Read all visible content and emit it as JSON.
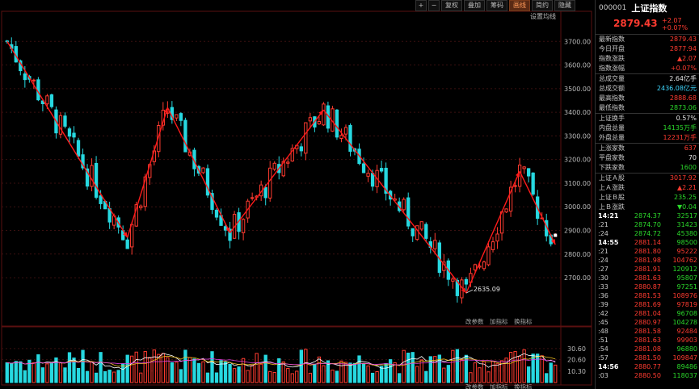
{
  "toolbar": {
    "items": [
      "+",
      "−",
      "复权",
      "叠加",
      "筹码",
      "画线",
      "简约",
      "隐藏"
    ],
    "active": "画线",
    "ma_setting": "设置均线"
  },
  "sub_labels": {
    "main_right": [
      "改参数",
      "加指标",
      "换指标"
    ],
    "vol_right": [
      "改参数",
      "加指标",
      "换指标"
    ]
  },
  "colors": {
    "up": "#ff3b30",
    "down": "#27d8e0",
    "zigzag": "#ff1a1a",
    "grid": "#3a1010"
  },
  "header": {
    "code": "000001",
    "name": "上证指数",
    "price": "2879.43",
    "change": "+2.07",
    "change_pct": "+0.07%"
  },
  "stats": [
    {
      "label": "最新指数",
      "value": "2879.43",
      "color": "red"
    },
    {
      "label": "今日开盘",
      "value": "2877.94",
      "color": "red"
    },
    {
      "label": "指数涨跌",
      "value": "▲2.07",
      "color": "red"
    },
    {
      "label": "指数涨幅",
      "value": "+0.07%",
      "color": "red"
    },
    {
      "label": "总成交量",
      "value": "2.64亿手",
      "color": "white"
    },
    {
      "label": "总成交额",
      "value": "2436.08亿元",
      "color": "cyan"
    },
    {
      "label": "最高指数",
      "value": "2888.68",
      "color": "red"
    },
    {
      "label": "最低指数",
      "value": "2873.06",
      "color": "green"
    },
    {
      "label": "上证换手",
      "value": "0.57%",
      "color": "white"
    },
    {
      "label": "内盘总量",
      "value": "14135万手",
      "color": "green"
    },
    {
      "label": "外盘总量",
      "value": "12231万手",
      "color": "red"
    },
    {
      "label": "上涨家数",
      "value": "637",
      "color": "red"
    },
    {
      "label": "平盘家数",
      "value": "70",
      "color": "white"
    },
    {
      "label": "下跌家数",
      "value": "1600",
      "color": "green"
    },
    {
      "label": "上证Ａ股",
      "value": "3017.92",
      "color": "red"
    },
    {
      "label": "上Ａ涨跌",
      "value": "▲2.21",
      "color": "red"
    },
    {
      "label": "上证Ｂ股",
      "value": "235.25",
      "color": "green"
    },
    {
      "label": "上Ｂ涨跌",
      "value": "▼0.04",
      "color": "green"
    }
  ],
  "ticks": [
    {
      "time": "14:21",
      "price": "2874.37",
      "vol": "32517",
      "pc": "green",
      "vc": "green"
    },
    {
      "time": ":21",
      "price": "2874.70",
      "vol": "31423",
      "pc": "green",
      "vc": "green"
    },
    {
      "time": ":24",
      "price": "2874.72",
      "vol": "45380",
      "pc": "green",
      "vc": "green"
    },
    {
      "time": "14:55",
      "price": "2881.14",
      "vol": "98500",
      "pc": "red",
      "vc": "green"
    },
    {
      "time": ":21",
      "price": "2881.80",
      "vol": "95222",
      "pc": "red",
      "vc": "red"
    },
    {
      "time": ":24",
      "price": "2881.98",
      "vol": "104762",
      "pc": "red",
      "vc": "red"
    },
    {
      "time": ":27",
      "price": "2881.91",
      "vol": "120912",
      "pc": "red",
      "vc": "green"
    },
    {
      "time": ":30",
      "price": "2881.63",
      "vol": "95807",
      "pc": "red",
      "vc": "green"
    },
    {
      "time": ":33",
      "price": "2880.87",
      "vol": "97251",
      "pc": "red",
      "vc": "green"
    },
    {
      "time": ":36",
      "price": "2881.53",
      "vol": "108976",
      "pc": "red",
      "vc": "red"
    },
    {
      "time": ":39",
      "price": "2881.69",
      "vol": "97819",
      "pc": "red",
      "vc": "red"
    },
    {
      "time": ":42",
      "price": "2881.04",
      "vol": "96708",
      "pc": "red",
      "vc": "green"
    },
    {
      "time": ":45",
      "price": "2880.97",
      "vol": "104278",
      "pc": "red",
      "vc": "green"
    },
    {
      "time": ":48",
      "price": "2881.58",
      "vol": "92484",
      "pc": "red",
      "vc": "red"
    },
    {
      "time": ":51",
      "price": "2881.63",
      "vol": "99903",
      "pc": "red",
      "vc": "red"
    },
    {
      "time": ":54",
      "price": "2881.08",
      "vol": "96880",
      "pc": "red",
      "vc": "green"
    },
    {
      "time": ":57",
      "price": "2881.50",
      "vol": "109847",
      "pc": "red",
      "vc": "red"
    },
    {
      "time": "14:56",
      "price": "2880.77",
      "vol": "89486",
      "pc": "red",
      "vc": "green"
    },
    {
      "time": ":03",
      "price": "2880.50",
      "vol": "118037",
      "pc": "red",
      "vc": "green"
    }
  ],
  "chart_data": {
    "type": "candlestick",
    "price_axis": {
      "ylim": [
        2550,
        3800
      ],
      "ticks": [
        2700,
        2800,
        2900,
        3000,
        3100,
        3200,
        3300,
        3400,
        3500,
        3600,
        3700
      ]
    },
    "volume_axis": {
      "ylim": [
        0,
        45
      ],
      "ticks": [
        "10.30",
        "20.60",
        "30.60"
      ]
    },
    "zigzag": [
      {
        "i": 0,
        "price": 3700
      },
      {
        "i": 27,
        "price": 2870
      },
      {
        "i": 36,
        "price": 3420
      },
      {
        "i": 50,
        "price": 2890
      },
      {
        "i": 71,
        "price": 3410
      },
      {
        "i": 103,
        "price": 2635
      },
      {
        "i": 115,
        "price": 3150
      },
      {
        "i": 123,
        "price": 2840
      }
    ],
    "low_annotation": {
      "text": "2635.09",
      "price": 2635.09,
      "i": 103
    },
    "candles": []
  }
}
